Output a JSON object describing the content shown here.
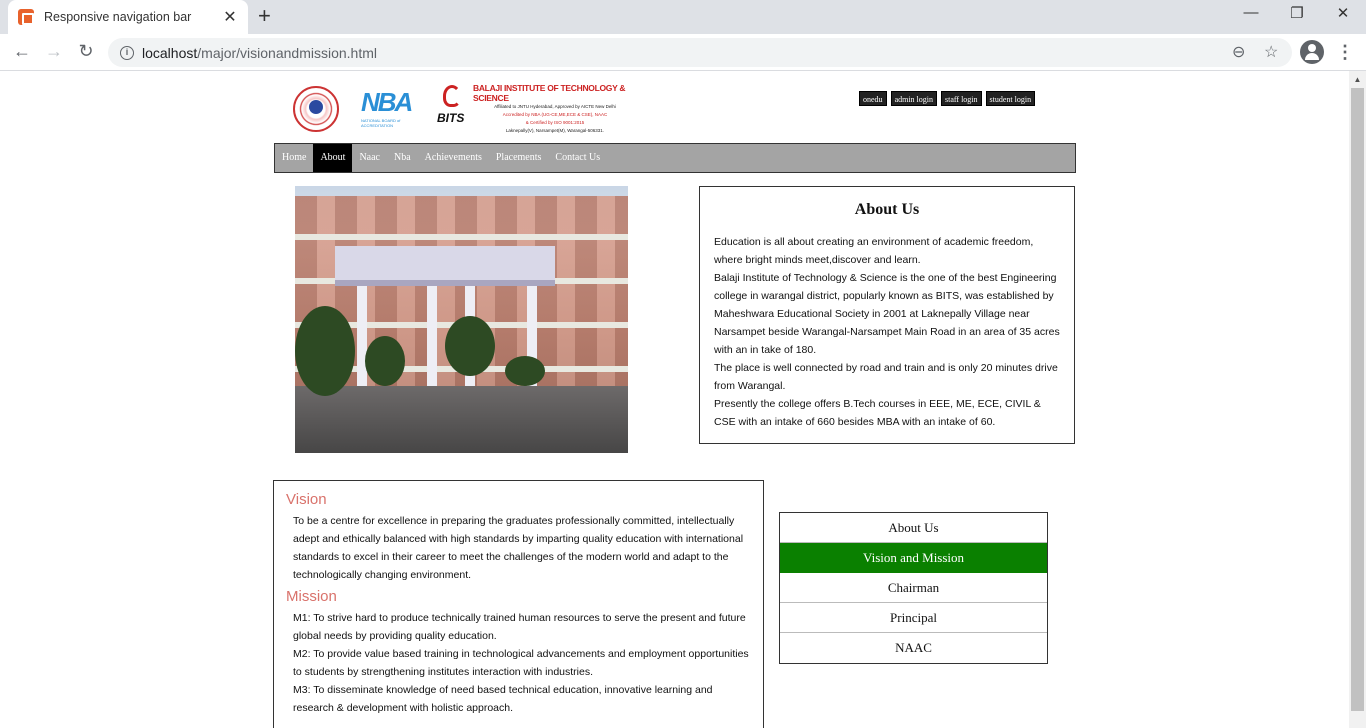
{
  "browser": {
    "tab_title": "Responsive navigation bar",
    "tab_close": "✕",
    "new_tab": "+",
    "url_host": "localhost",
    "url_path": "/major/visionandmission.html",
    "window_controls": [
      "—",
      "❐",
      "✕"
    ]
  },
  "header": {
    "bits_name": "BALAJI INSTITUTE OF TECHNOLOGY & SCIENCE",
    "bits_lines": [
      "Affiliated to JNTU Hyderabad, Approved by AICTE New Delhi",
      "Accredited by NBA (UG-CE,ME,ECE & CSE), NAAC",
      "& Certified by ISO 9001:2015",
      "Laknepally(V), Narsampet(M), Warangal-506331."
    ],
    "bits_word": "BITS",
    "nba_text": "NBA",
    "nba_sub": "NATIONAL BOARD of ACCREDITATION"
  },
  "login_buttons": [
    "onedu",
    "admin login",
    "staff login",
    "student login"
  ],
  "nav": {
    "items": [
      "Home",
      "About",
      "Naac",
      "Nba",
      "Achievements",
      "Placements",
      "Contact Us"
    ],
    "active": "About"
  },
  "about": {
    "title": "About Us",
    "paragraphs": [
      "Education is all about creating an environment of academic freedom, where bright minds meet,discover and learn.",
      "Balaji Institute of Technology & Science is the one of the best Engineering college in warangal district, popularly known as BITS, was established by Maheshwara Educational Society in 2001 at Laknepally Village near Narsampet beside Warangal-Narsampet Main Road in an area of 35 acres with an in take of 180.",
      "The place is well connected by road and train and is only 20 minutes drive from Warangal.",
      "Presently the college offers B.Tech courses in EEE, ME, ECE, CIVIL & CSE with an intake of 660 besides MBA with an intake of 60."
    ]
  },
  "vision": {
    "heading": "Vision",
    "text": "To be a centre for excellence in preparing the graduates professionally committed, intellectually adept and ethically balanced with high standards by imparting quality education with international standards to excel in their career to meet the challenges of the modern world and adapt to the technologically changing environment."
  },
  "mission": {
    "heading": "Mission",
    "items": [
      "M1: To strive hard to produce technically trained human resources to serve the present and future global needs by providing quality education.",
      "M2: To provide value based training in technological advancements and employment opportunities to students by strengthening institutes interaction with industries.",
      "M3: To disseminate knowledge of need based technical education, innovative learning and research & development with holistic approach."
    ]
  },
  "side_menu": {
    "items": [
      "About Us",
      "Vision and Mission",
      "Chairman",
      "Principal",
      "NAAC"
    ],
    "active": "Vision and Mission"
  },
  "colors": {
    "active_side": "#0a8000",
    "heading_accent": "#d9726b",
    "nav_bg": "#a4a4a4"
  }
}
